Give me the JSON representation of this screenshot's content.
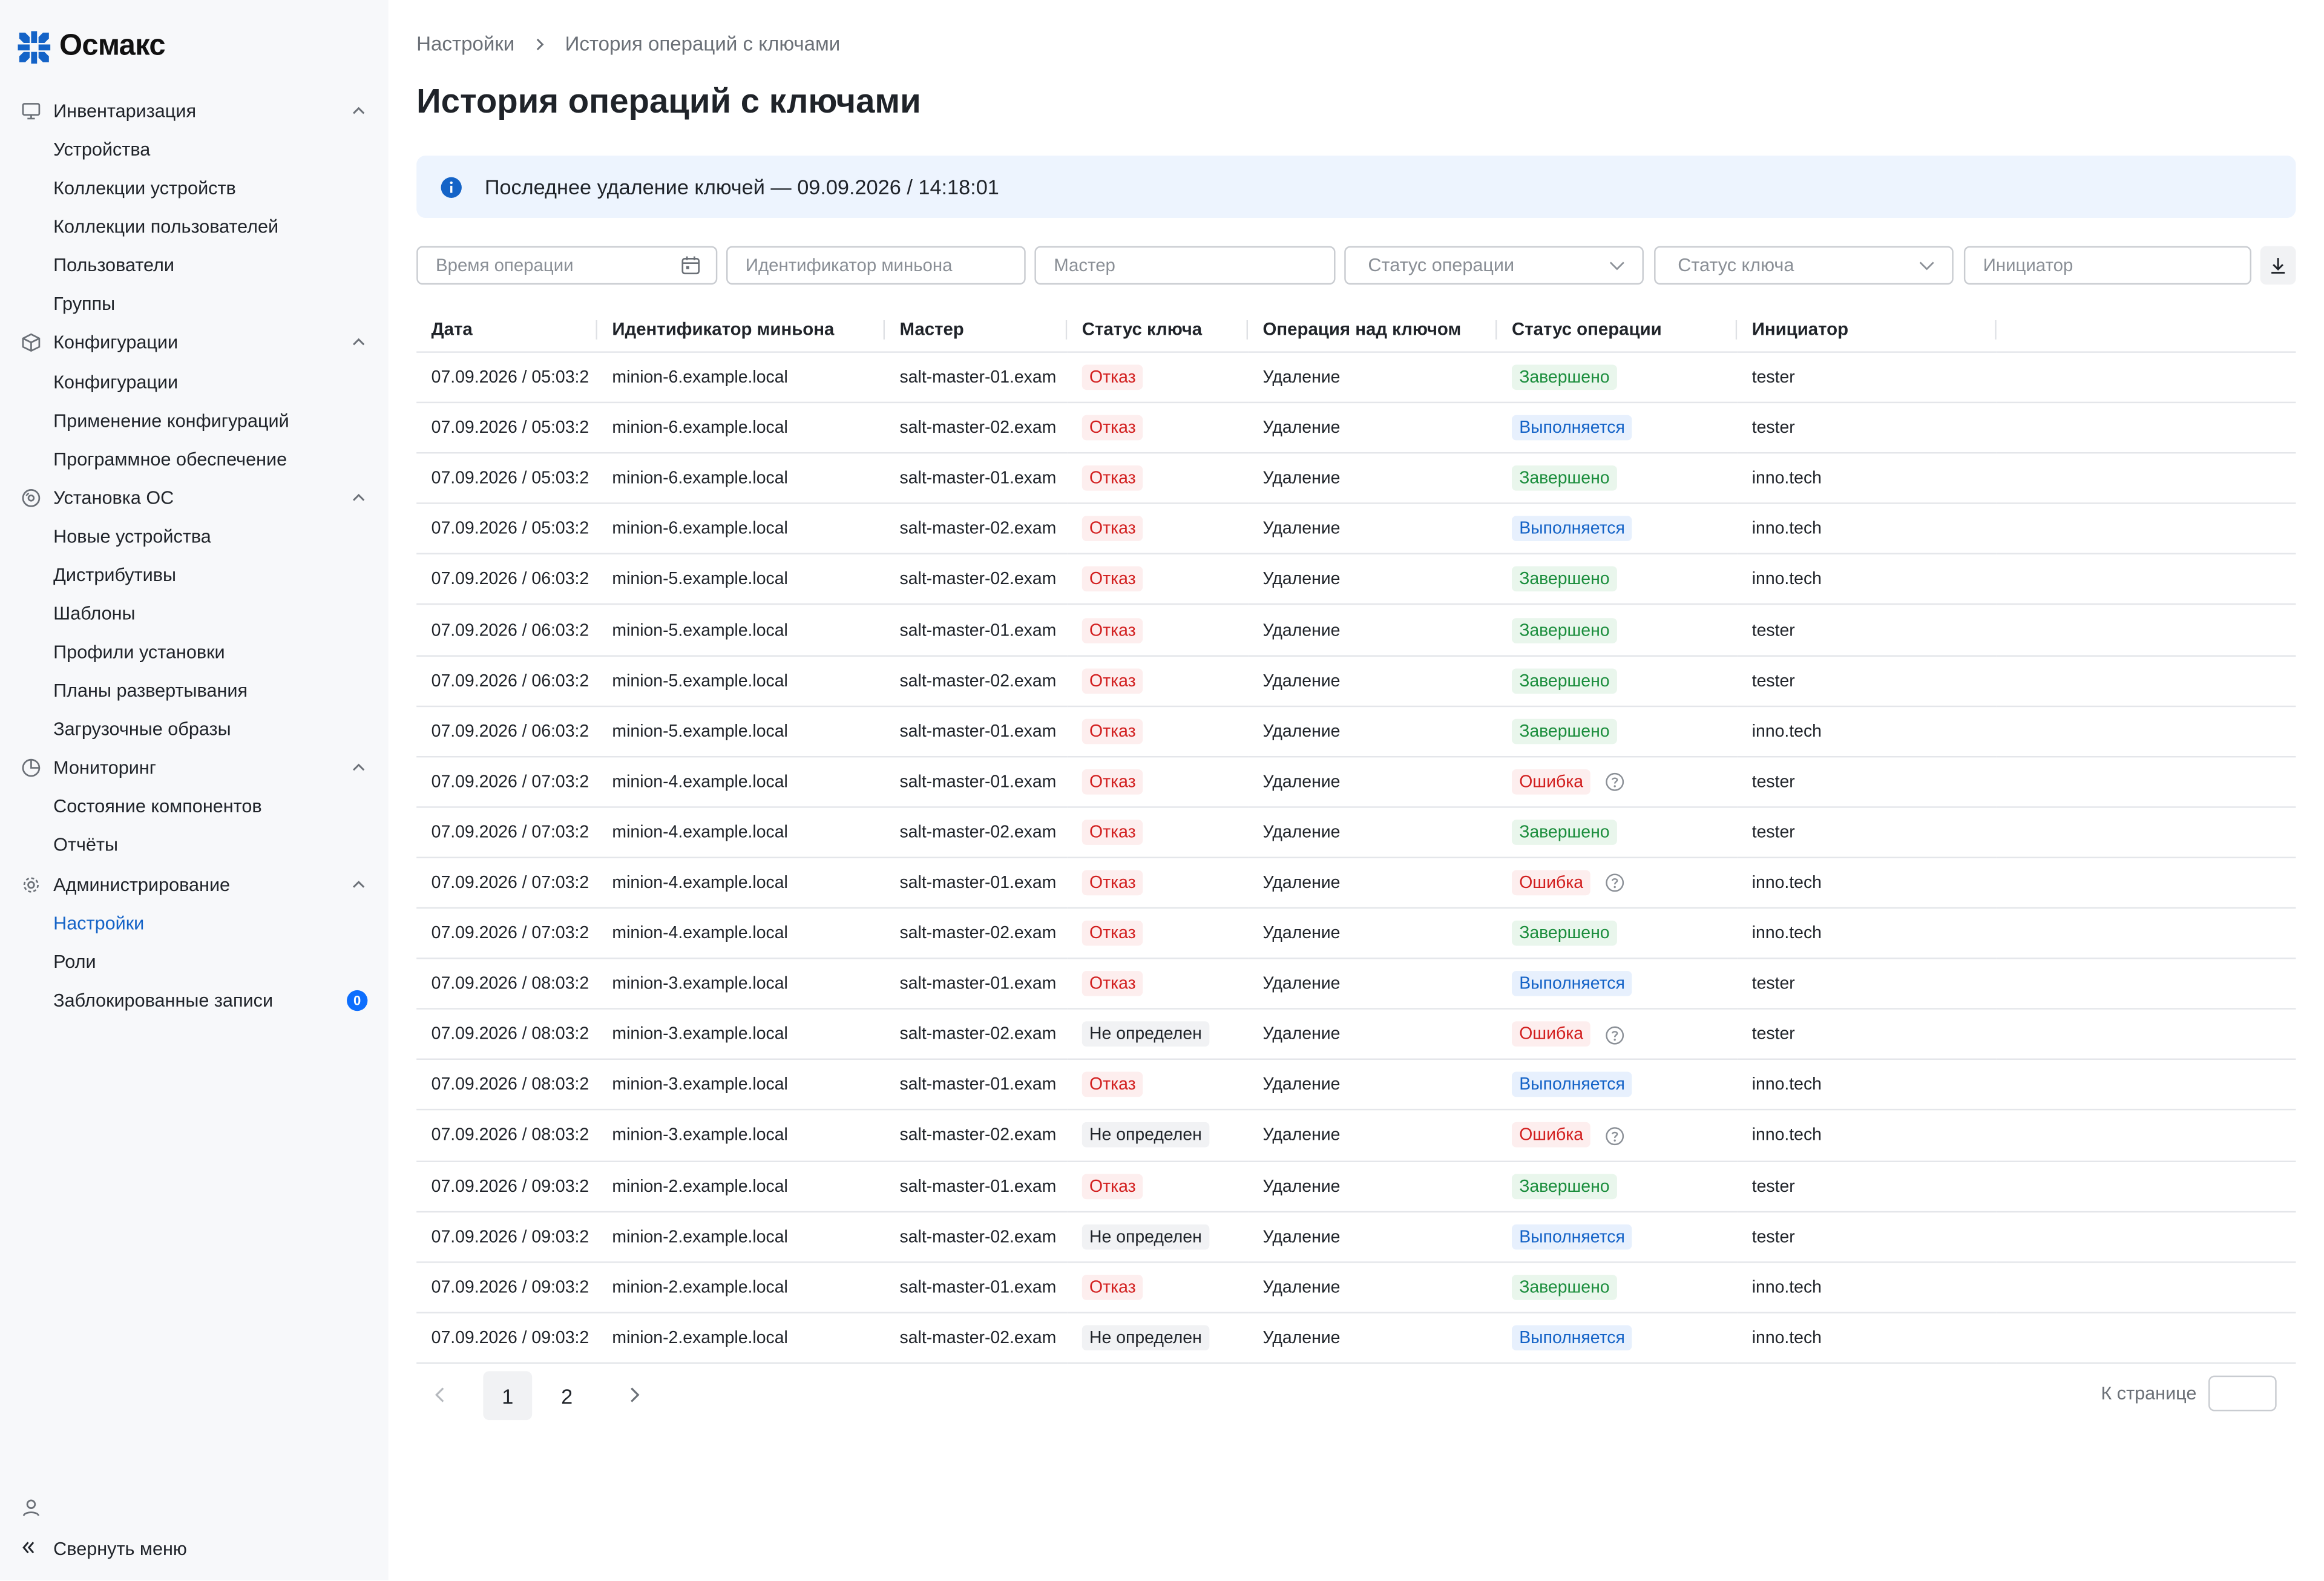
{
  "app": {
    "logo_text": "Осмакс"
  },
  "sidebar": {
    "groups": [
      {
        "label": "Инвентаризация",
        "icon": "monitor-icon",
        "items": [
          {
            "label": "Устройства"
          },
          {
            "label": "Коллекции устройств"
          },
          {
            "label": "Коллекции пользователей"
          },
          {
            "label": "Пользователи"
          },
          {
            "label": "Группы"
          }
        ]
      },
      {
        "label": "Конфигурации",
        "icon": "cube-icon",
        "items": [
          {
            "label": "Конфигурации"
          },
          {
            "label": "Применение конфигураций"
          },
          {
            "label": "Программное обеспечение"
          }
        ]
      },
      {
        "label": "Установка ОС",
        "icon": "disc-icon",
        "items": [
          {
            "label": "Новые устройства"
          },
          {
            "label": "Дистрибутивы"
          },
          {
            "label": "Шаблоны"
          },
          {
            "label": "Профили установки"
          },
          {
            "label": "Планы развертывания"
          },
          {
            "label": "Загрузочные образы"
          }
        ]
      },
      {
        "label": "Мониторинг",
        "icon": "pie-icon",
        "items": [
          {
            "label": "Состояние компонентов"
          },
          {
            "label": "Отчёты"
          }
        ]
      },
      {
        "label": "Администрирование",
        "icon": "gear-icon",
        "items": [
          {
            "label": "Настройки",
            "active": true
          },
          {
            "label": "Роли"
          },
          {
            "label": "Заблокированные записи",
            "badge": "0"
          }
        ]
      }
    ],
    "collapse_label": "Свернуть меню"
  },
  "breadcrumb": [
    "Настройки",
    "История операций с ключами"
  ],
  "page_title": "История операций с ключами",
  "alert": {
    "text": "Последнее удаление ключей — 09.09.2026 / 14:18:01"
  },
  "filters": {
    "time_placeholder": "Время операции",
    "minion_placeholder": "Идентификатор миньона",
    "master_placeholder": "Мастер",
    "op_status_label": "Статус операции",
    "key_status_label": "Статус ключа",
    "initiator_placeholder": "Инициатор"
  },
  "table": {
    "columns": [
      "Дата",
      "Идентификатор миньона",
      "Мастер",
      "Статус ключа",
      "Операция над ключом",
      "Статус операции",
      "Инициатор"
    ],
    "rows": [
      {
        "date": "07.09.2026 / 05:03:2",
        "minion": "minion-6.example.local",
        "master": "salt-master-01.exam",
        "key_status": "Отказ",
        "key_status_kind": "red",
        "operation": "Удаление",
        "op_status": "Завершено",
        "op_status_kind": "green",
        "initiator": "tester"
      },
      {
        "date": "07.09.2026 / 05:03:2",
        "minion": "minion-6.example.local",
        "master": "salt-master-02.exam",
        "key_status": "Отказ",
        "key_status_kind": "red",
        "operation": "Удаление",
        "op_status": "Выполняется",
        "op_status_kind": "blue",
        "initiator": "tester"
      },
      {
        "date": "07.09.2026 / 05:03:2",
        "minion": "minion-6.example.local",
        "master": "salt-master-01.exam",
        "key_status": "Отказ",
        "key_status_kind": "red",
        "operation": "Удаление",
        "op_status": "Завершено",
        "op_status_kind": "green",
        "initiator": "inno.tech"
      },
      {
        "date": "07.09.2026 / 05:03:2",
        "minion": "minion-6.example.local",
        "master": "salt-master-02.exam",
        "key_status": "Отказ",
        "key_status_kind": "red",
        "operation": "Удаление",
        "op_status": "Выполняется",
        "op_status_kind": "blue",
        "initiator": "inno.tech"
      },
      {
        "date": "07.09.2026 / 06:03:2",
        "minion": "minion-5.example.local",
        "master": "salt-master-02.exam",
        "key_status": "Отказ",
        "key_status_kind": "red",
        "operation": "Удаление",
        "op_status": "Завершено",
        "op_status_kind": "green",
        "initiator": "inno.tech"
      },
      {
        "date": "07.09.2026 / 06:03:2",
        "minion": "minion-5.example.local",
        "master": "salt-master-01.exam",
        "key_status": "Отказ",
        "key_status_kind": "red",
        "operation": "Удаление",
        "op_status": "Завершено",
        "op_status_kind": "green",
        "initiator": "tester"
      },
      {
        "date": "07.09.2026 / 06:03:2",
        "minion": "minion-5.example.local",
        "master": "salt-master-02.exam",
        "key_status": "Отказ",
        "key_status_kind": "red",
        "operation": "Удаление",
        "op_status": "Завершено",
        "op_status_kind": "green",
        "initiator": "tester"
      },
      {
        "date": "07.09.2026 / 06:03:2",
        "minion": "minion-5.example.local",
        "master": "salt-master-01.exam",
        "key_status": "Отказ",
        "key_status_kind": "red",
        "operation": "Удаление",
        "op_status": "Завершено",
        "op_status_kind": "green",
        "initiator": "inno.tech"
      },
      {
        "date": "07.09.2026 / 07:03:2",
        "minion": "minion-4.example.local",
        "master": "salt-master-01.exam",
        "key_status": "Отказ",
        "key_status_kind": "red",
        "operation": "Удаление",
        "op_status": "Ошибка",
        "op_status_kind": "red",
        "initiator": "tester"
      },
      {
        "date": "07.09.2026 / 07:03:2",
        "minion": "minion-4.example.local",
        "master": "salt-master-02.exam",
        "key_status": "Отказ",
        "key_status_kind": "red",
        "operation": "Удаление",
        "op_status": "Завершено",
        "op_status_kind": "green",
        "initiator": "tester"
      },
      {
        "date": "07.09.2026 / 07:03:2",
        "minion": "minion-4.example.local",
        "master": "salt-master-01.exam",
        "key_status": "Отказ",
        "key_status_kind": "red",
        "operation": "Удаление",
        "op_status": "Ошибка",
        "op_status_kind": "red",
        "initiator": "inno.tech"
      },
      {
        "date": "07.09.2026 / 07:03:2",
        "minion": "minion-4.example.local",
        "master": "salt-master-02.exam",
        "key_status": "Отказ",
        "key_status_kind": "red",
        "operation": "Удаление",
        "op_status": "Завершено",
        "op_status_kind": "green",
        "initiator": "inno.tech"
      },
      {
        "date": "07.09.2026 / 08:03:2",
        "minion": "minion-3.example.local",
        "master": "salt-master-01.exam",
        "key_status": "Отказ",
        "key_status_kind": "red",
        "operation": "Удаление",
        "op_status": "Выполняется",
        "op_status_kind": "blue",
        "initiator": "tester"
      },
      {
        "date": "07.09.2026 / 08:03:2",
        "minion": "minion-3.example.local",
        "master": "salt-master-02.exam",
        "key_status": "Не определен",
        "key_status_kind": "gray",
        "operation": "Удаление",
        "op_status": "Ошибка",
        "op_status_kind": "red",
        "initiator": "tester"
      },
      {
        "date": "07.09.2026 / 08:03:2",
        "minion": "minion-3.example.local",
        "master": "salt-master-01.exam",
        "key_status": "Отказ",
        "key_status_kind": "red",
        "operation": "Удаление",
        "op_status": "Выполняется",
        "op_status_kind": "blue",
        "initiator": "inno.tech"
      },
      {
        "date": "07.09.2026 / 08:03:2",
        "minion": "minion-3.example.local",
        "master": "salt-master-02.exam",
        "key_status": "Не определен",
        "key_status_kind": "gray",
        "operation": "Удаление",
        "op_status": "Ошибка",
        "op_status_kind": "red",
        "initiator": "inno.tech"
      },
      {
        "date": "07.09.2026 / 09:03:2",
        "minion": "minion-2.example.local",
        "master": "salt-master-01.exam",
        "key_status": "Отказ",
        "key_status_kind": "red",
        "operation": "Удаление",
        "op_status": "Завершено",
        "op_status_kind": "green",
        "initiator": "tester"
      },
      {
        "date": "07.09.2026 / 09:03:2",
        "minion": "minion-2.example.local",
        "master": "salt-master-02.exam",
        "key_status": "Не определен",
        "key_status_kind": "gray",
        "operation": "Удаление",
        "op_status": "Выполняется",
        "op_status_kind": "blue",
        "initiator": "tester"
      },
      {
        "date": "07.09.2026 / 09:03:2",
        "minion": "minion-2.example.local",
        "master": "salt-master-01.exam",
        "key_status": "Отказ",
        "key_status_kind": "red",
        "operation": "Удаление",
        "op_status": "Завершено",
        "op_status_kind": "green",
        "initiator": "inno.tech"
      },
      {
        "date": "07.09.2026 / 09:03:2",
        "minion": "minion-2.example.local",
        "master": "salt-master-02.exam",
        "key_status": "Не определен",
        "key_status_kind": "gray",
        "operation": "Удаление",
        "op_status": "Выполняется",
        "op_status_kind": "blue",
        "initiator": "inno.tech"
      }
    ]
  },
  "pagination": {
    "pages": [
      "1",
      "2"
    ],
    "current": "1",
    "goto_label": "К странице"
  },
  "colors": {
    "accent": "#1463c7",
    "badge": "#0d6efd",
    "sidebar_bg": "#f7f8fa",
    "alert_bg": "#edf4fe"
  }
}
